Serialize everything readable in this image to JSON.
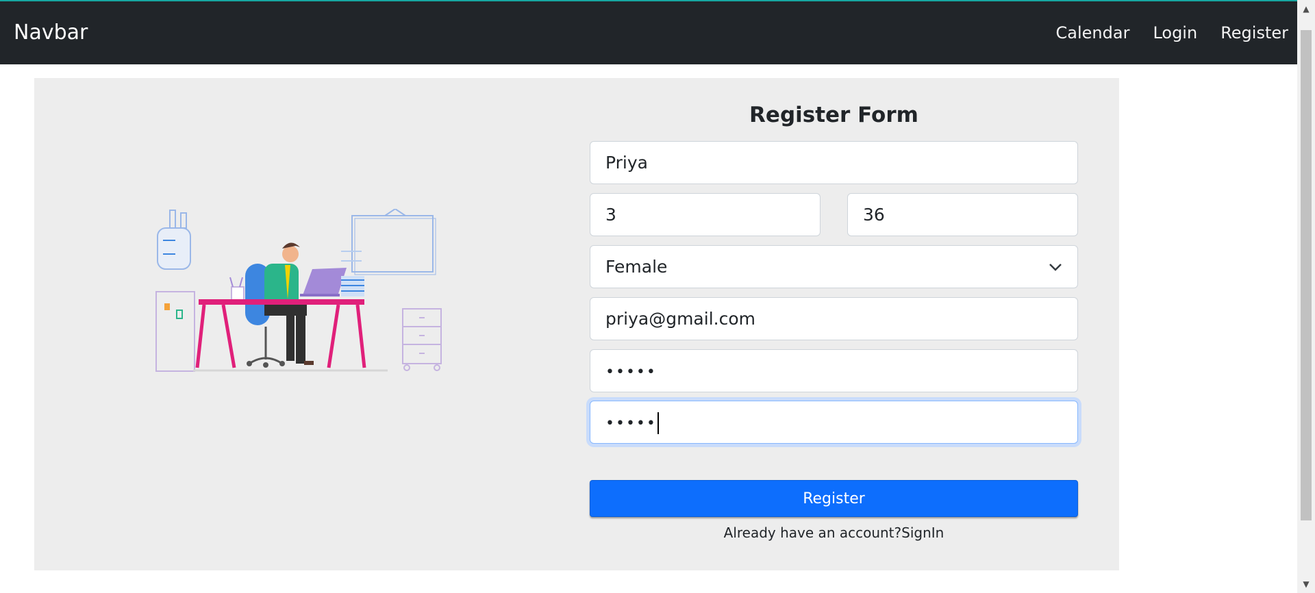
{
  "navbar": {
    "brand": "Navbar",
    "links": [
      {
        "label": "Calendar"
      },
      {
        "label": "Login"
      },
      {
        "label": "Register"
      }
    ]
  },
  "form": {
    "title": "Register Form",
    "name_value": "Priya",
    "field2_value": "3",
    "field3_value": "36",
    "gender_selected": "Female",
    "email_value": "priya@gmail.com",
    "password_masked": "•••••",
    "confirm_masked": "•••••",
    "submit_label": "Register",
    "footer_text": "Already have an account?",
    "footer_link": "SignIn"
  },
  "colors": {
    "navbar_bg": "#212529",
    "panel_bg": "#ededed",
    "primary": "#0d6efd",
    "desk_pink": "#e0207a",
    "shirt_green": "#2bb58a",
    "chair_blue": "#3d86e0",
    "laptop_purple": "#a38ad8"
  }
}
